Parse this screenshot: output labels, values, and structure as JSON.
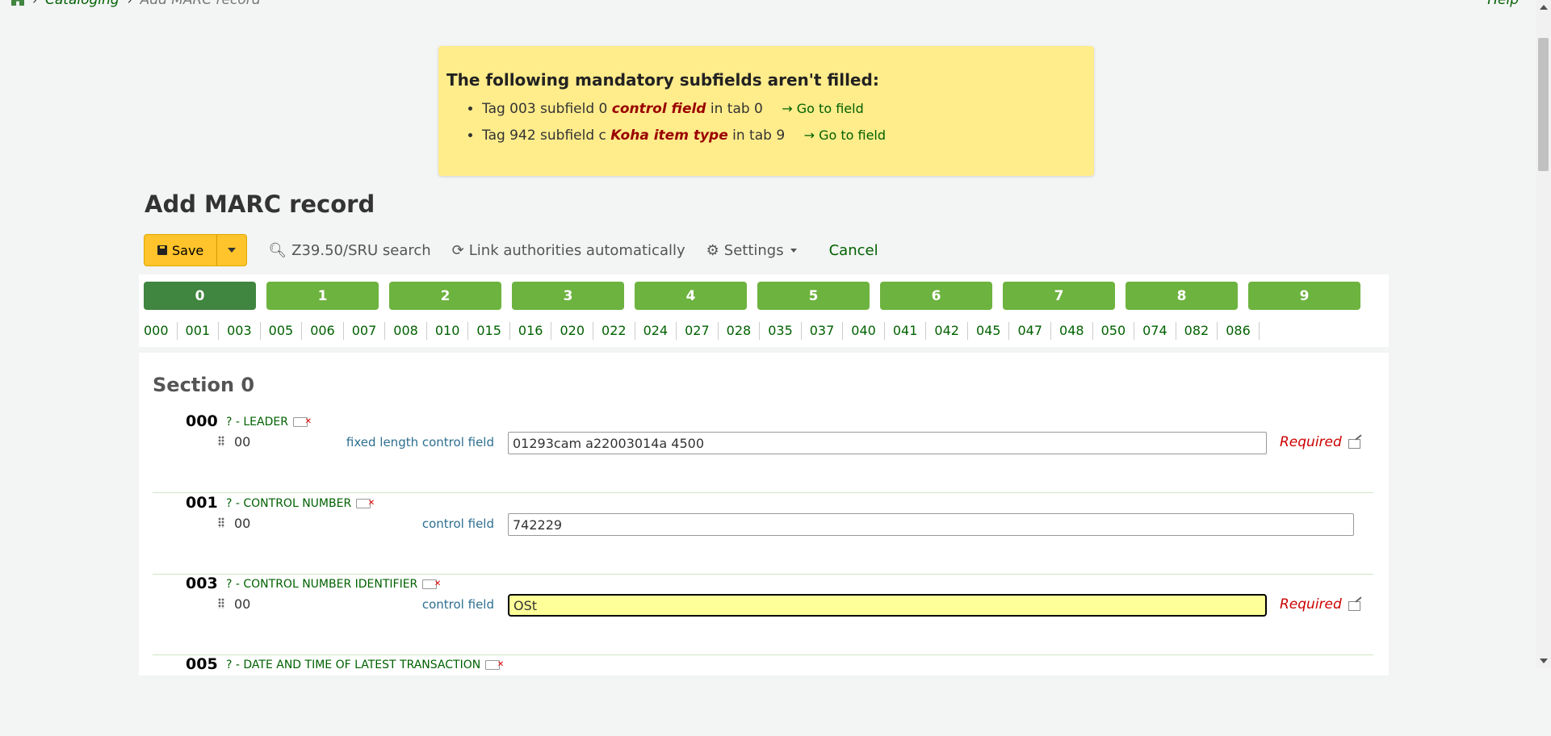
{
  "breadcrumb": {
    "items": [
      "Cataloging",
      "Add MARC record"
    ],
    "help": "Help"
  },
  "alert": {
    "title": "The following mandatory subfields aren't filled:",
    "items": [
      {
        "pre": "Tag 003 subfield 0 ",
        "field": "control field",
        "post": " in tab 0",
        "link": "Go to field"
      },
      {
        "pre": "Tag 942 subfield c ",
        "field": "Koha item type",
        "post": " in tab 9",
        "link": "Go to field"
      }
    ]
  },
  "page_title": "Add MARC record",
  "toolbar": {
    "save_label": "Save",
    "z3950_label": "Z39.50/SRU search",
    "link_auth_label": "Link authorities automatically",
    "settings_label": "Settings",
    "cancel_label": "Cancel"
  },
  "tabs": [
    "0",
    "1",
    "2",
    "3",
    "4",
    "5",
    "6",
    "7",
    "8",
    "9"
  ],
  "active_tab": "0",
  "tag_links": [
    "000",
    "001",
    "003",
    "005",
    "006",
    "007",
    "008",
    "010",
    "015",
    "016",
    "020",
    "022",
    "024",
    "027",
    "028",
    "035",
    "037",
    "040",
    "041",
    "042",
    "045",
    "047",
    "048",
    "050",
    "074",
    "082",
    "086"
  ],
  "section": {
    "title": "Section 0",
    "fields": [
      {
        "tag": "000",
        "label": "? - LEADER",
        "subcode": "00",
        "sublabel": "fixed length control field",
        "value": "01293cam a22003014a 4500",
        "required": "Required"
      },
      {
        "tag": "001",
        "label": "? - CONTROL NUMBER",
        "subcode": "00",
        "sublabel": "control field",
        "value": "742229",
        "required": ""
      },
      {
        "tag": "003",
        "label": "? - CONTROL NUMBER IDENTIFIER",
        "subcode": "00",
        "sublabel": "control field",
        "value": "OSt",
        "required": "Required"
      },
      {
        "tag": "005",
        "label": "? - DATE AND TIME OF LATEST TRANSACTION"
      }
    ]
  },
  "colors": {
    "tab": "#6db33f",
    "tab_active": "#408540",
    "alert_bg": "#ffec8b",
    "save_btn": "#ffc32b",
    "required": "#cc0000",
    "focused_input": "#ffff99"
  }
}
